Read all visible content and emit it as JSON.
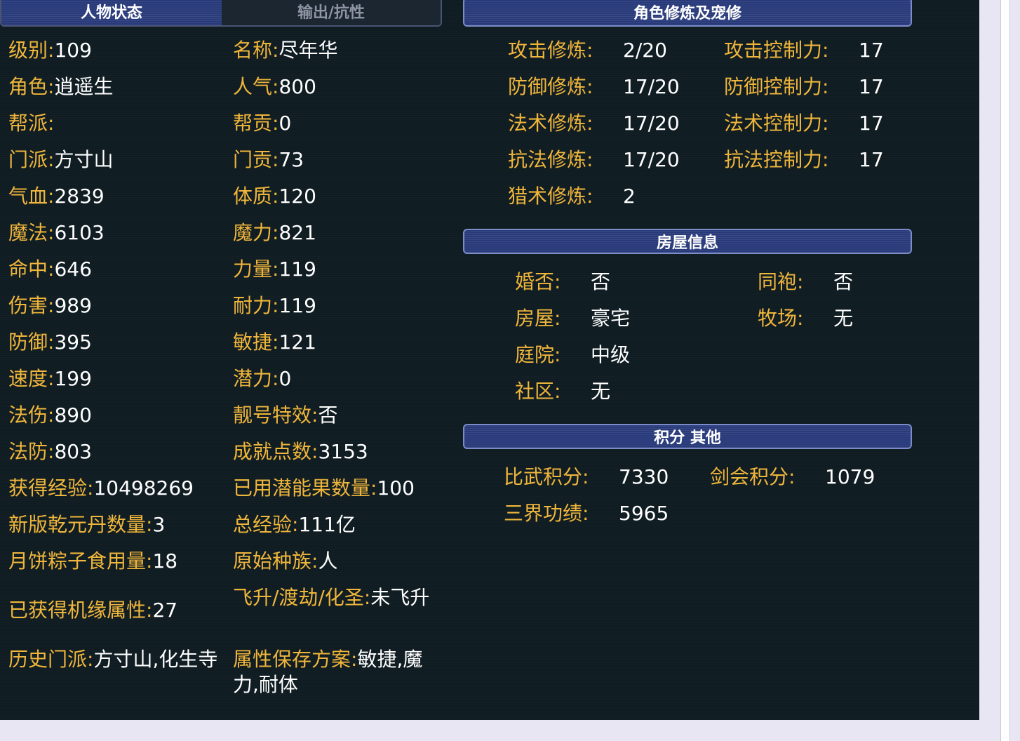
{
  "tabs": {
    "active": "人物状态",
    "inactive": "输出/抗性"
  },
  "char_left": [
    {
      "label": "级别:",
      "value": "109"
    },
    {
      "label": "角色:",
      "value": "逍遥生"
    },
    {
      "label": "帮派:",
      "value": ""
    },
    {
      "label": "门派:",
      "value": "方寸山"
    },
    {
      "label": "气血:",
      "value": "2839"
    },
    {
      "label": "魔法:",
      "value": "6103"
    },
    {
      "label": "命中:",
      "value": "646"
    },
    {
      "label": "伤害:",
      "value": "989"
    },
    {
      "label": "防御:",
      "value": "395"
    },
    {
      "label": "速度:",
      "value": "199"
    },
    {
      "label": "法伤:",
      "value": "890"
    },
    {
      "label": "法防:",
      "value": "803"
    },
    {
      "label": "获得经验:",
      "value": "10498269"
    },
    {
      "label": "新版乾元丹数量:",
      "value": "3"
    },
    {
      "label": "月饼粽子食用量:",
      "value": "18"
    },
    {
      "label": "已获得机缘属性:",
      "value": "27"
    },
    {
      "label": "历史门派:",
      "value": "方寸山,化生寺"
    }
  ],
  "char_right": [
    {
      "label": "名称:",
      "value": "尽年华"
    },
    {
      "label": "人气:",
      "value": "800"
    },
    {
      "label": "帮贡:",
      "value": "0"
    },
    {
      "label": "门贡:",
      "value": "73"
    },
    {
      "label": "体质:",
      "value": "120"
    },
    {
      "label": "魔力:",
      "value": "821"
    },
    {
      "label": "力量:",
      "value": "119"
    },
    {
      "label": "耐力:",
      "value": "119"
    },
    {
      "label": "敏捷:",
      "value": "121"
    },
    {
      "label": "潜力:",
      "value": "0"
    },
    {
      "label": "靓号特效:",
      "value": "否"
    },
    {
      "label": "成就点数:",
      "value": "3153"
    },
    {
      "label": "已用潜能果数量:",
      "value": "100"
    },
    {
      "label": "总经验:",
      "value": "111亿"
    },
    {
      "label": "原始种族:",
      "value": "人"
    },
    {
      "label": "飞升/渡劫/化圣:",
      "value": "未飞升"
    },
    {
      "label": "属性保存方案:",
      "value": "敏捷,魔力,耐体"
    }
  ],
  "cultivation": {
    "title": "角色修炼及宠修",
    "rows": [
      {
        "label": "攻击修炼:",
        "value": "2/20",
        "label2": "攻击控制力:",
        "value2": "17"
      },
      {
        "label": "防御修炼:",
        "value": "17/20",
        "label2": "防御控制力:",
        "value2": "17"
      },
      {
        "label": "法术修炼:",
        "value": "17/20",
        "label2": "法术控制力:",
        "value2": "17"
      },
      {
        "label": "抗法修炼:",
        "value": "17/20",
        "label2": "抗法控制力:",
        "value2": "17"
      },
      {
        "label": "猎术修炼:",
        "value": "2",
        "label2": "",
        "value2": ""
      }
    ]
  },
  "house": {
    "title": "房屋信息",
    "rows": [
      {
        "label": "婚否:",
        "value": "否",
        "label2": "同袍:",
        "value2": "否"
      },
      {
        "label": "房屋:",
        "value": "豪宅",
        "label2": "牧场:",
        "value2": "无"
      },
      {
        "label": "庭院:",
        "value": "中级",
        "label2": "",
        "value2": ""
      },
      {
        "label": "社区:",
        "value": "无",
        "label2": "",
        "value2": ""
      }
    ]
  },
  "points": {
    "title": "积分 其他",
    "rows": [
      {
        "label": "比武积分:",
        "value": "7330",
        "label2": "剑会积分:",
        "value2": "1079"
      },
      {
        "label": "三界功绩:",
        "value": "5965",
        "label2": "",
        "value2": ""
      }
    ]
  },
  "colors": {
    "label": "#f0b63b",
    "value": "#ffffff",
    "panel": "#0f1c22",
    "header": "#283a7a"
  }
}
